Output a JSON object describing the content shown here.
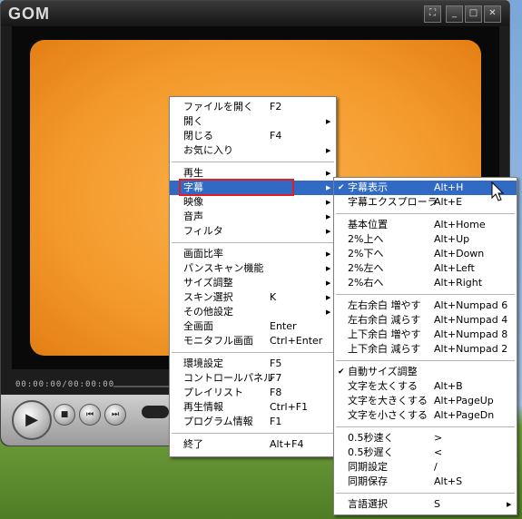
{
  "app": {
    "logo": "GOM",
    "title_buttons": [
      "⛶",
      "_",
      "□",
      "✕"
    ],
    "timecode": "00:00:00/00:00:00"
  },
  "controls": {
    "play_icon": "play-icon",
    "stop_icon": "stop-icon",
    "prev_icon": "prev-icon",
    "next_icon": "next-icon"
  },
  "main_menu": {
    "items": [
      {
        "label": "ファイルを開く",
        "shortcut": "F2",
        "submenu": false
      },
      {
        "label": "開く",
        "shortcut": "",
        "submenu": true
      },
      {
        "label": "閉じる",
        "shortcut": "F4",
        "submenu": false
      },
      {
        "label": "お気に入り",
        "shortcut": "",
        "submenu": true
      },
      {
        "sep": true
      },
      {
        "label": "再生",
        "shortcut": "",
        "submenu": true
      },
      {
        "label": "字幕",
        "shortcut": "",
        "submenu": true,
        "highlighted": true
      },
      {
        "label": "映像",
        "shortcut": "",
        "submenu": true
      },
      {
        "label": "音声",
        "shortcut": "",
        "submenu": true
      },
      {
        "label": "フィルタ",
        "shortcut": "",
        "submenu": true
      },
      {
        "sep": true
      },
      {
        "label": "画面比率",
        "shortcut": "",
        "submenu": true
      },
      {
        "label": "パンスキャン機能",
        "shortcut": "",
        "submenu": true
      },
      {
        "label": "サイズ調整",
        "shortcut": "",
        "submenu": true
      },
      {
        "label": "スキン選択",
        "shortcut": "K",
        "submenu": true
      },
      {
        "label": "その他設定",
        "shortcut": "",
        "submenu": true
      },
      {
        "label": "全画面",
        "shortcut": "Enter",
        "submenu": false
      },
      {
        "label": "モニタフル画面",
        "shortcut": "Ctrl+Enter",
        "submenu": false
      },
      {
        "sep": true
      },
      {
        "label": "環境設定",
        "shortcut": "F5",
        "submenu": false
      },
      {
        "label": "コントロールパネル",
        "shortcut": "F7",
        "submenu": false
      },
      {
        "label": "プレイリスト",
        "shortcut": "F8",
        "submenu": false
      },
      {
        "label": "再生情報",
        "shortcut": "Ctrl+F1",
        "submenu": false
      },
      {
        "label": "プログラム情報",
        "shortcut": "F1",
        "submenu": false
      },
      {
        "sep": true
      },
      {
        "label": "終了",
        "shortcut": "Alt+F4",
        "submenu": false
      }
    ]
  },
  "sub_menu": {
    "items": [
      {
        "label": "字幕表示",
        "shortcut": "Alt+H",
        "checked": true,
        "highlighted": true
      },
      {
        "label": "字幕エクスプローラ",
        "shortcut": "Alt+E"
      },
      {
        "sep": true
      },
      {
        "label": "基本位置",
        "shortcut": "Alt+Home"
      },
      {
        "label": "2%上へ",
        "shortcut": "Alt+Up"
      },
      {
        "label": "2%下へ",
        "shortcut": "Alt+Down"
      },
      {
        "label": "2%左へ",
        "shortcut": "Alt+Left"
      },
      {
        "label": "2%右へ",
        "shortcut": "Alt+Right"
      },
      {
        "sep": true
      },
      {
        "label": "左右余白 増やす",
        "shortcut": "Alt+Numpad 6"
      },
      {
        "label": "左右余白 減らす",
        "shortcut": "Alt+Numpad 4"
      },
      {
        "label": "上下余白 増やす",
        "shortcut": "Alt+Numpad 8"
      },
      {
        "label": "上下余白 減らす",
        "shortcut": "Alt+Numpad 2"
      },
      {
        "sep": true
      },
      {
        "label": "自動サイズ調整",
        "shortcut": "",
        "checked": true
      },
      {
        "label": "文字を太くする",
        "shortcut": "Alt+B"
      },
      {
        "label": "文字を大きくする",
        "shortcut": "Alt+PageUp"
      },
      {
        "label": "文字を小さくする",
        "shortcut": "Alt+PageDn"
      },
      {
        "sep": true
      },
      {
        "label": "0.5秒速く",
        "shortcut": ">"
      },
      {
        "label": "0.5秒遅く",
        "shortcut": "<"
      },
      {
        "label": "同期設定",
        "shortcut": "/"
      },
      {
        "label": "同期保存",
        "shortcut": "Alt+S"
      },
      {
        "sep": true
      },
      {
        "label": "言語選択",
        "shortcut": "S",
        "submenu": true
      }
    ]
  },
  "colors": {
    "highlight": "#316ac5",
    "annotation": "#e02020",
    "video": "#f49a2c"
  }
}
